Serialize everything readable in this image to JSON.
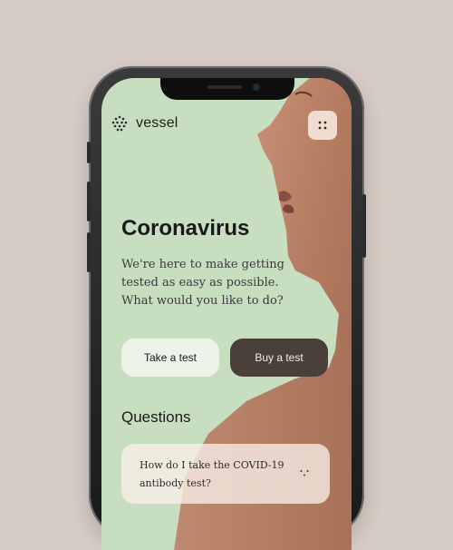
{
  "brand": {
    "name": "vessel",
    "logo_icon": "dotted-circle-logo-icon"
  },
  "header": {
    "menu_icon": "four-dots-menu-icon"
  },
  "hero": {
    "title": "Coronavirus",
    "subtitle": "We're here to make getting tested as easy as possible. What would you like to do?"
  },
  "actions": {
    "primary_label": "Take a test",
    "secondary_label": "Buy a test"
  },
  "questions": {
    "title": "Questions",
    "items": [
      {
        "text": "How do I take the COVID-19 antibody test?",
        "icon": "expand-dots-icon"
      }
    ]
  },
  "colors": {
    "background": "#d8ccc6",
    "screen_bg": "#c8dec1",
    "dark_button": "#4b3f3a",
    "light_button": "#eef3ea",
    "menu_button": "#f0ddd0"
  }
}
